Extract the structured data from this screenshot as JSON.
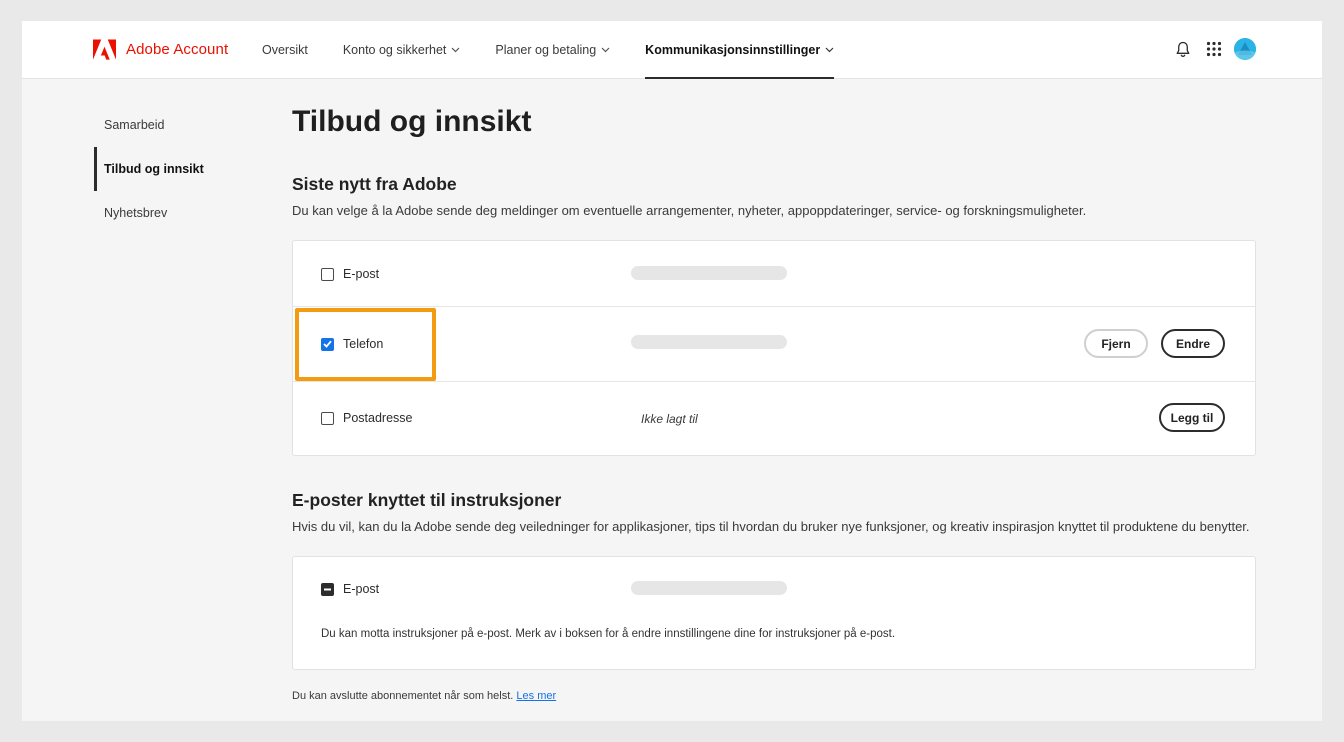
{
  "header": {
    "brand": "Adobe Account",
    "nav": [
      {
        "label": "Oversikt",
        "dropdown": false,
        "active": false
      },
      {
        "label": "Konto og sikkerhet",
        "dropdown": true,
        "active": false
      },
      {
        "label": "Planer og betaling",
        "dropdown": true,
        "active": false
      },
      {
        "label": "Kommunikasjonsinnstillinger",
        "dropdown": true,
        "active": true
      }
    ],
    "icons": [
      "bell-icon",
      "app-grid-icon",
      "avatar"
    ]
  },
  "sidebar": {
    "items": [
      {
        "label": "Samarbeid",
        "active": false
      },
      {
        "label": "Tilbud og innsikt",
        "active": true
      },
      {
        "label": "Nyhetsbrev",
        "active": false
      }
    ]
  },
  "main": {
    "title": "Tilbud og innsikt",
    "section1": {
      "title": "Siste nytt fra Adobe",
      "description": "Du kan velge å la Adobe sende deg meldinger om eventuelle arrangementer, nyheter, appoppdateringer, service- og forskningsmuligheter.",
      "rows": [
        {
          "label": "E-post",
          "checked": false,
          "value": ""
        },
        {
          "label": "Telefon",
          "checked": true,
          "value": "",
          "buttons": [
            "Fjern",
            "Endre"
          ]
        },
        {
          "label": "Postadresse",
          "checked": false,
          "value": "Ikke lagt til",
          "buttons": [
            "Legg til"
          ]
        }
      ]
    },
    "section2": {
      "title": "E-poster knyttet til instruksjoner",
      "description": "Hvis du vil, kan du la Adobe sende deg veiledninger for applikasjoner, tips til hvordan du bruker nye funksjoner, og kreativ inspirasjon knyttet til produktene du benytter.",
      "row": {
        "label": "E-post",
        "state": "indeterminate"
      },
      "note": "Du kan motta instruksjoner på e-post. Merk av i boksen for å endre innstillingene dine for instruksjoner på e-post."
    },
    "footer": {
      "text": "Du kan avslutte abonnementet når som helst.",
      "link": "Les mer"
    }
  },
  "colors": {
    "brand": "#eb1000",
    "checkbox_checked": "#1473e6",
    "highlight": "#f39c12",
    "avatar": "#2bb3e6"
  }
}
